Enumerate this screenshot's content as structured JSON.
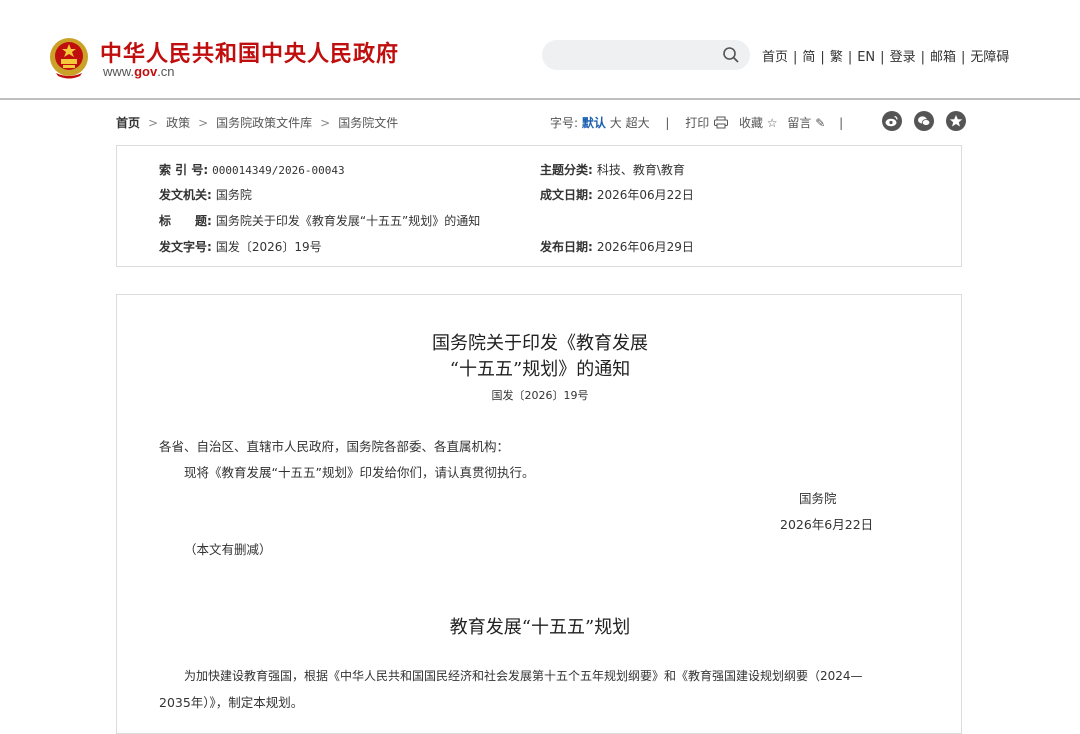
{
  "site": {
    "name": "中华人民共和国中央人民政府",
    "url_prefix": "www.",
    "url_brand": "gov",
    "url_suffix": ".cn"
  },
  "search": {
    "placeholder": ""
  },
  "topnav": [
    "首页",
    "简",
    "繁",
    "EN",
    "登录",
    "邮箱",
    "无障碍"
  ],
  "breadcrumb": {
    "home": "首页",
    "items": [
      "政策",
      "国务院政策文件库",
      "国务院文件"
    ]
  },
  "tools": {
    "font_label": "字号:",
    "default": "默认",
    "large": "大",
    "xlarge": "超大",
    "print": "打印",
    "favorite": "收藏",
    "comment": "留言"
  },
  "meta": {
    "index_key": "索 引 号:",
    "index_val": "000014349/2026-00043",
    "category_key": "主题分类:",
    "category_val": "科技、教育\\教育",
    "issuer_key": "发文机关:",
    "issuer_val": "国务院",
    "created_key": "成文日期:",
    "created_val": "2026年06月22日",
    "title_key": "标　　题:",
    "title_val": "国务院关于印发《教育发展“十五五”规划》的通知",
    "docno_key": "发文字号:",
    "docno_val": "国发〔2026〕19号",
    "published_key": "发布日期:",
    "published_val": "2026年06月29日"
  },
  "article": {
    "title_line1": "国务院关于印发《教育发展",
    "title_line2": "“十五五”规划》的通知",
    "doc_number": "国发〔2026〕19号",
    "salutation": "各省、自治区、直辖市人民政府，国务院各部委、各直属机构：",
    "body": "现将《教育发展“十五五”规划》印发给你们，请认真贯彻执行。",
    "signature": "国务院",
    "date": "2026年6月22日",
    "note": "（本文有删减）",
    "section_title": "教育发展“十五五”规划",
    "para_line1": "为加快建设教育强国，根据《中华人民共和国国民经济和社会发展第十五个五年规划纲要》和《教育强国建设规划纲要（2024—",
    "para_line2": "2035年）》，制定本规划。"
  },
  "colors": {
    "brand_red": "#c00d0d",
    "link_blue": "#1b5fb0",
    "border": "#dcdcdc"
  }
}
